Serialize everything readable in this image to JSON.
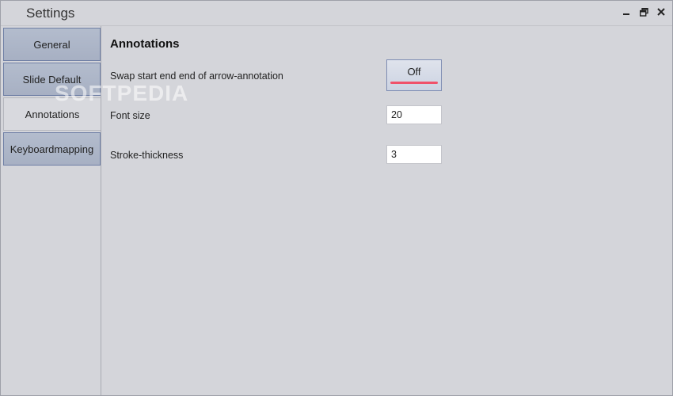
{
  "window": {
    "title": "Settings",
    "controls": [
      "minimize-icon",
      "restore-icon",
      "close-icon"
    ]
  },
  "sidebar": {
    "items": [
      {
        "label": "General",
        "active": false
      },
      {
        "label": "Slide Default",
        "active": false
      },
      {
        "label": "Annotations",
        "active": true
      },
      {
        "label": "Keyboardmapping",
        "active": false
      }
    ]
  },
  "annotations": {
    "title": "Annotations",
    "swap_label": "Swap start end end of arrow-annotation",
    "swap_value": "Off",
    "font_size_label": "Font size",
    "font_size_value": "20",
    "stroke_label": "Stroke-thickness",
    "stroke_value": "3"
  },
  "watermark": "SOFTPEDIA",
  "colors": {
    "tab_bg": "#a7b0c3",
    "tab_border": "#6f7fa5",
    "toggle_indicator": "#f0516a",
    "window_bg": "#d4d5da"
  }
}
